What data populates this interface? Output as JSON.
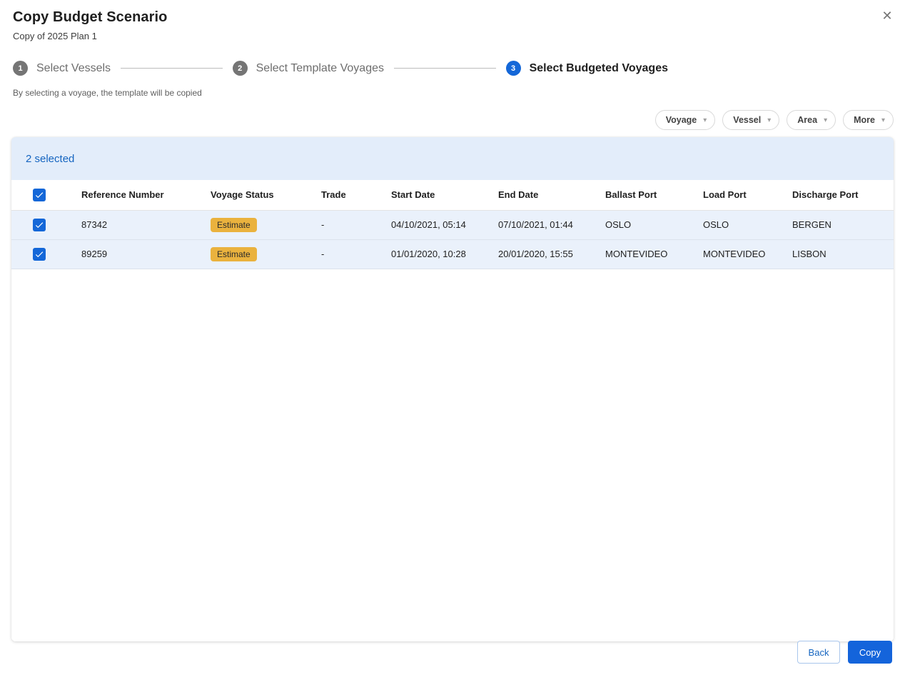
{
  "dialog": {
    "title": "Copy Budget Scenario",
    "subtitle": "Copy of 2025 Plan 1"
  },
  "icons": {
    "close": "✕",
    "dropdown_caret": "▾"
  },
  "stepper": {
    "steps": [
      {
        "number": "1",
        "label": "Select Vessels",
        "active": false
      },
      {
        "number": "2",
        "label": "Select Template Voyages",
        "active": false
      },
      {
        "number": "3",
        "label": "Select Budgeted Voyages",
        "active": true
      }
    ]
  },
  "helper_text": "By selecting a voyage, the template will be copied",
  "filters": [
    {
      "label": "Voyage"
    },
    {
      "label": "Vessel"
    },
    {
      "label": "Area"
    },
    {
      "label": "More"
    }
  ],
  "table": {
    "selection_summary": "2 selected",
    "columns": [
      "Reference Number",
      "Voyage Status",
      "Trade",
      "Start Date",
      "End Date",
      "Ballast Port",
      "Load Port",
      "Discharge Port"
    ],
    "select_all_checked": true,
    "rows": [
      {
        "selected": true,
        "reference_number": "87342",
        "voyage_status": "Estimate",
        "trade": "-",
        "start_date": "04/10/2021, 05:14",
        "end_date": "07/10/2021, 01:44",
        "ballast_port": "OSLO",
        "load_port": "OSLO",
        "discharge_port": "BERGEN"
      },
      {
        "selected": true,
        "reference_number": "89259",
        "voyage_status": "Estimate",
        "trade": "-",
        "start_date": "01/01/2020, 10:28",
        "end_date": "20/01/2020, 15:55",
        "ballast_port": "MONTEVIDEO",
        "load_port": "MONTEVIDEO",
        "discharge_port": "LISBON"
      }
    ]
  },
  "footer": {
    "back_label": "Back",
    "copy_label": "Copy"
  },
  "colors": {
    "primary_blue": "#1467d8",
    "copy_button_blue": "#1464db",
    "selection_bar_bg": "#e3edfa",
    "selected_row_bg": "#eaf1fb",
    "selection_text": "#1565c0",
    "badge_bg": "#eab23e",
    "step_inactive_gray": "#757575"
  }
}
